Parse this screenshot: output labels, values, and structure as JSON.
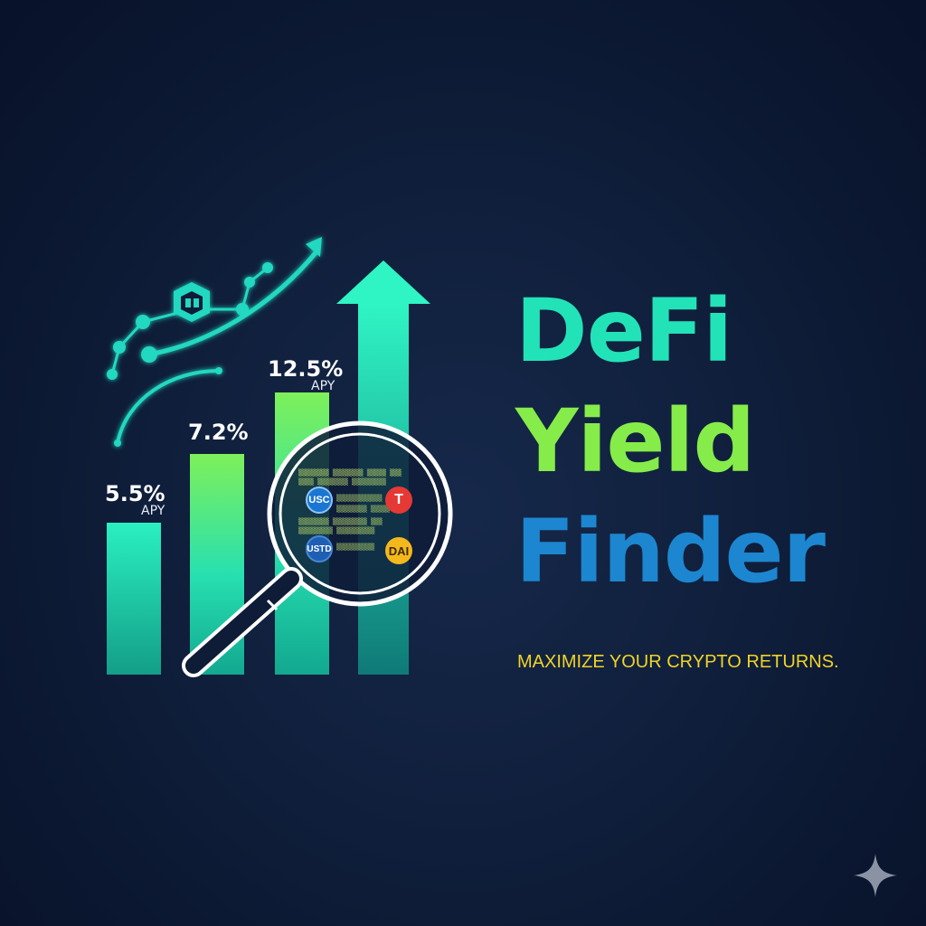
{
  "title": {
    "line1": "DeFi",
    "line2": "Yield",
    "line3": "Finder"
  },
  "tagline": "MAXIMIZE YOUR CRYPTO RETURNS.",
  "bars": [
    {
      "value": "5.5%",
      "sub": "APY"
    },
    {
      "value": "7.2%",
      "sub": ""
    },
    {
      "value": "12.5%",
      "sub": "APY"
    }
  ],
  "tokens": {
    "usc": "USC",
    "t": "T",
    "usdt": "USTD",
    "dai": "DAI"
  },
  "icons": [
    "growth-arrow-icon",
    "magnifier-icon",
    "network-nodes-icon",
    "blockchain-cube-icon",
    "sparkle-icon"
  ],
  "colors": {
    "background": "#0e1c38",
    "teal": "#22e3b8",
    "green": "#86ec4a",
    "blue": "#1d86d0",
    "yellow": "#f1d326"
  }
}
